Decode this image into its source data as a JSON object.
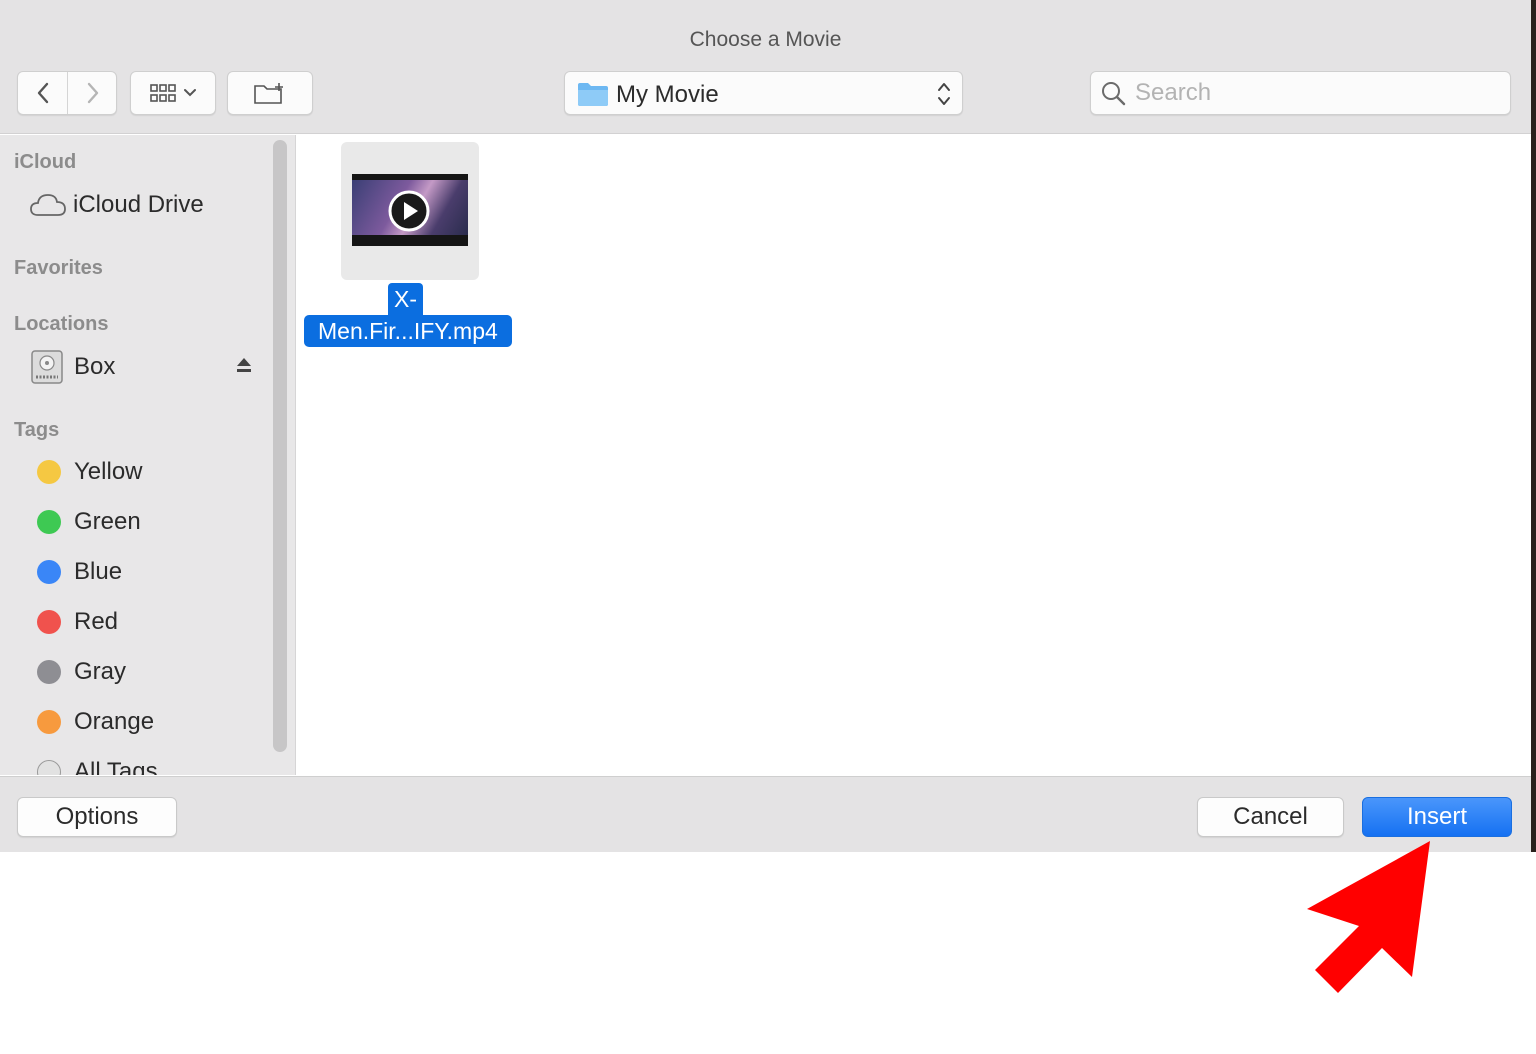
{
  "window": {
    "title": "Choose a Movie"
  },
  "toolbar": {
    "location": "My Movie",
    "search_placeholder": "Search"
  },
  "sidebar": {
    "sections": {
      "icloud": "iCloud",
      "favorites": "Favorites",
      "locations": "Locations",
      "tags": "Tags"
    },
    "icloud_items": [
      {
        "label": "iCloud Drive",
        "icon": "cloud-icon"
      }
    ],
    "location_items": [
      {
        "label": "Box",
        "icon": "external-drive-icon"
      }
    ],
    "tags": [
      {
        "label": "Yellow",
        "color": "#f5c842"
      },
      {
        "label": "Green",
        "color": "#3ec953"
      },
      {
        "label": "Blue",
        "color": "#3a86f7"
      },
      {
        "label": "Red",
        "color": "#f0524d"
      },
      {
        "label": "Gray",
        "color": "#8e8e93"
      },
      {
        "label": "Orange",
        "color": "#f79a3e"
      },
      {
        "label": "All Tags",
        "color": "#d9d9d9"
      }
    ]
  },
  "files": [
    {
      "name_line1": "X-",
      "name_line2": "Men.Fir...IFY.mp4",
      "icon": "video-thumbnail",
      "selected": true
    }
  ],
  "footer": {
    "options_label": "Options",
    "cancel_label": "Cancel",
    "insert_label": "Insert"
  },
  "annotation": {
    "arrow_color": "#ff0000",
    "icon": "red-pointer-arrow"
  }
}
